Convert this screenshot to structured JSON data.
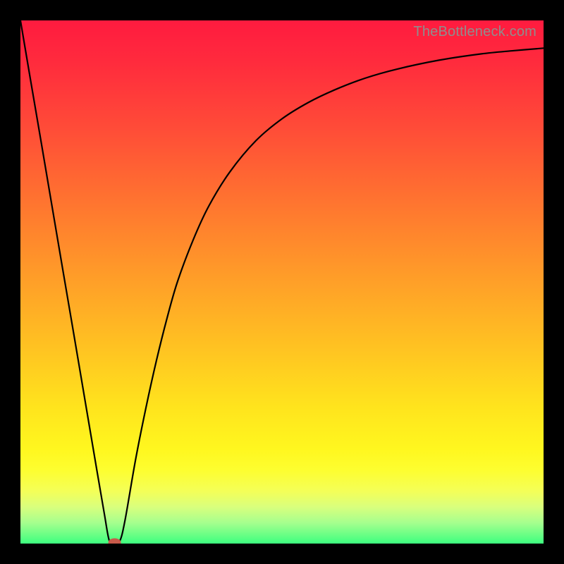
{
  "attribution": "TheBottleneck.com",
  "colors": {
    "frame": "#000000",
    "curve": "#000000",
    "marker": "#c85a4a"
  },
  "chart_data": {
    "type": "line",
    "title": "",
    "xlabel": "",
    "ylabel": "",
    "xlim": [
      0,
      100
    ],
    "ylim": [
      0,
      100
    ],
    "x": [
      0,
      2,
      4,
      6,
      8,
      10,
      12,
      14,
      16,
      17,
      18,
      19,
      20,
      22,
      24,
      26,
      28,
      30,
      33,
      36,
      40,
      45,
      50,
      55,
      60,
      66,
      72,
      80,
      88,
      94,
      100
    ],
    "values": [
      100,
      88.2,
      76.5,
      64.7,
      52.9,
      41.2,
      29.4,
      17.6,
      5.9,
      0.5,
      0.2,
      0.5,
      4.5,
      16,
      26,
      35,
      43,
      50,
      58,
      64.5,
      71,
      77,
      81.2,
      84.3,
      86.7,
      89,
      90.7,
      92.4,
      93.6,
      94.2,
      94.7
    ],
    "marker": {
      "x": 18,
      "y": 0.2
    },
    "notes": "V-shaped curve: steep linear descent from top-left to a minimum near x≈18, then an asymptotic rise toward ~95 at the right edge. No axis ticks or labels are rendered."
  }
}
